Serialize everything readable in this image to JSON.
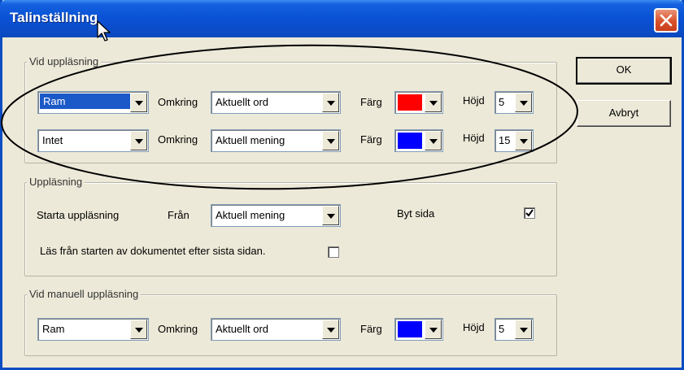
{
  "window": {
    "title": "Talinställning"
  },
  "buttons": {
    "ok": "OK",
    "cancel": "Avbryt"
  },
  "vid_upplasning": {
    "legend": "Vid uppläsning",
    "rows": [
      {
        "type": "Ram",
        "omkring_label": "Omkring",
        "omkring": "Aktuellt ord",
        "farg_label": "Färg",
        "color": "#ff0000",
        "hojd_label": "Höjd",
        "hojd": "5"
      },
      {
        "type": "Intet",
        "omkring_label": "Omkring",
        "omkring": "Aktuell mening",
        "farg_label": "Färg",
        "color": "#0000ff",
        "hojd_label": "Höjd",
        "hojd": "15"
      }
    ]
  },
  "upplasning": {
    "legend": "Uppläsning",
    "start_label": "Starta uppläsning",
    "fran_label": "Från",
    "fran": "Aktuell mening",
    "byt_sida_label": "Byt sida",
    "byt_sida_checked": true,
    "las_fran_label": "Läs från starten av dokumentet efter sista sidan.",
    "las_fran_checked": false
  },
  "vid_manuell": {
    "legend": "Vid manuell uppläsning",
    "row": {
      "type": "Ram",
      "omkring_label": "Omkring",
      "omkring": "Aktuellt ord",
      "farg_label": "Färg",
      "color": "#0000ff",
      "hojd_label": "Höjd",
      "hojd": "5"
    }
  }
}
